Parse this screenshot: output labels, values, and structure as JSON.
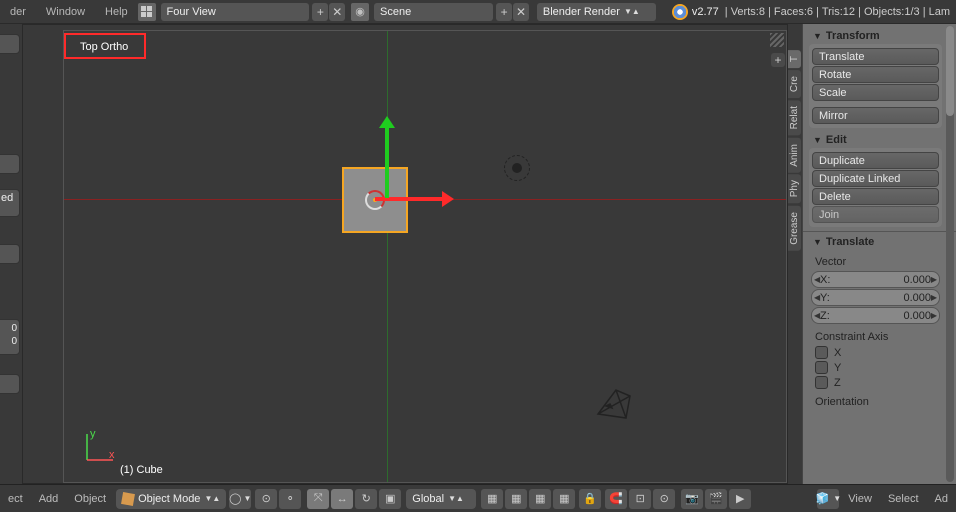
{
  "topbar": {
    "menu_render": "der",
    "menu_window": "Window",
    "menu_help": "Help",
    "layout_name": "Four View",
    "scene_name": "Scene",
    "engine": "Blender Render",
    "version": "v2.77",
    "stats": "Verts:8 | Faces:6 | Tris:12 | Objects:1/3 | Lam"
  },
  "left": {
    "stub1": "ed",
    "stub2": "0\n0"
  },
  "viewport": {
    "label": "Top Ortho",
    "object": "(1) Cube",
    "axis_x": "x",
    "axis_y": "y"
  },
  "right_tabs": [
    "Grease",
    "Phy",
    "Anim",
    "Relat",
    "Cre",
    "T"
  ],
  "panels": {
    "transform": {
      "title": "Transform",
      "translate": "Translate",
      "rotate": "Rotate",
      "scale": "Scale",
      "mirror": "Mirror"
    },
    "edit": {
      "title": "Edit",
      "duplicate": "Duplicate",
      "duplicate_linked": "Duplicate Linked",
      "delete": "Delete",
      "join": "Join"
    },
    "translate_panel": {
      "title": "Translate",
      "vector_label": "Vector",
      "x_label": "X:",
      "y_label": "Y:",
      "z_label": "Z:",
      "x_val": "0.000",
      "y_val": "0.000",
      "z_val": "0.000",
      "constraint_label": "Constraint Axis",
      "cx": "X",
      "cy": "Y",
      "cz": "Z",
      "orientation_label": "Orientation"
    }
  },
  "bottombar": {
    "select": "ect",
    "add": "Add",
    "object": "Object",
    "mode": "Object Mode",
    "orient": "Global",
    "right_view": "View",
    "right_select": "Select",
    "right_add": "Ad"
  }
}
